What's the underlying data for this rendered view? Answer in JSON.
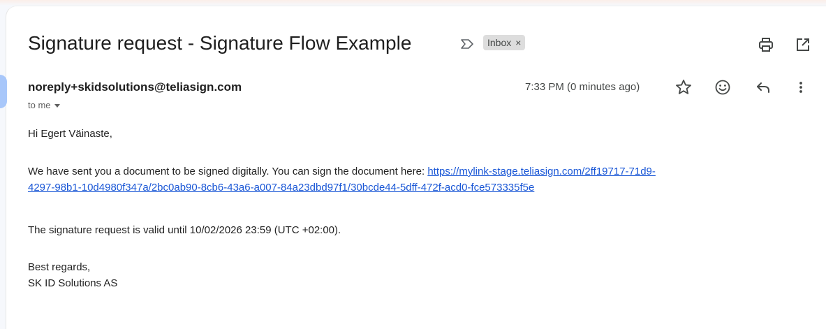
{
  "email": {
    "subject": "Signature request - Signature Flow Example",
    "label": "Inbox",
    "label_remove": "×",
    "sender": "noreply+skidsolutions@teliasign.com",
    "recipient_line": "to me",
    "timestamp": "7:33 PM (0 minutes ago)",
    "body": {
      "greeting": "Hi Egert Väinaste,",
      "intro": "We have sent you a document to be signed digitally. You can sign the document here: ",
      "link_line1": "https://mylink-stage.teliasign.com/2ff19717-71d9-",
      "link_line2": "4297-98b1-10d4980f347a/2bc0ab90-8cb6-43a6-a007-84a23dbd97f1/30bcde44-5dff-472f-acd0-fce573335f5e",
      "validity": "The signature request is valid until 10/02/2026 23:59 (UTC +02:00).",
      "closing": "Best regards,",
      "signature": "SK ID Solutions AS"
    }
  },
  "icons": {
    "important": "important-marker-icon",
    "print": "print-icon",
    "popout": "open-in-new-window-icon",
    "star": "star-icon",
    "emoji": "emoji-reaction-icon",
    "reply": "reply-icon",
    "more": "more-vertical-icon",
    "caret": "chevron-down-icon"
  },
  "colors": {
    "link": "#1a57d6",
    "label_chip": "#dddddd",
    "avatar": "#a8c7fa"
  }
}
